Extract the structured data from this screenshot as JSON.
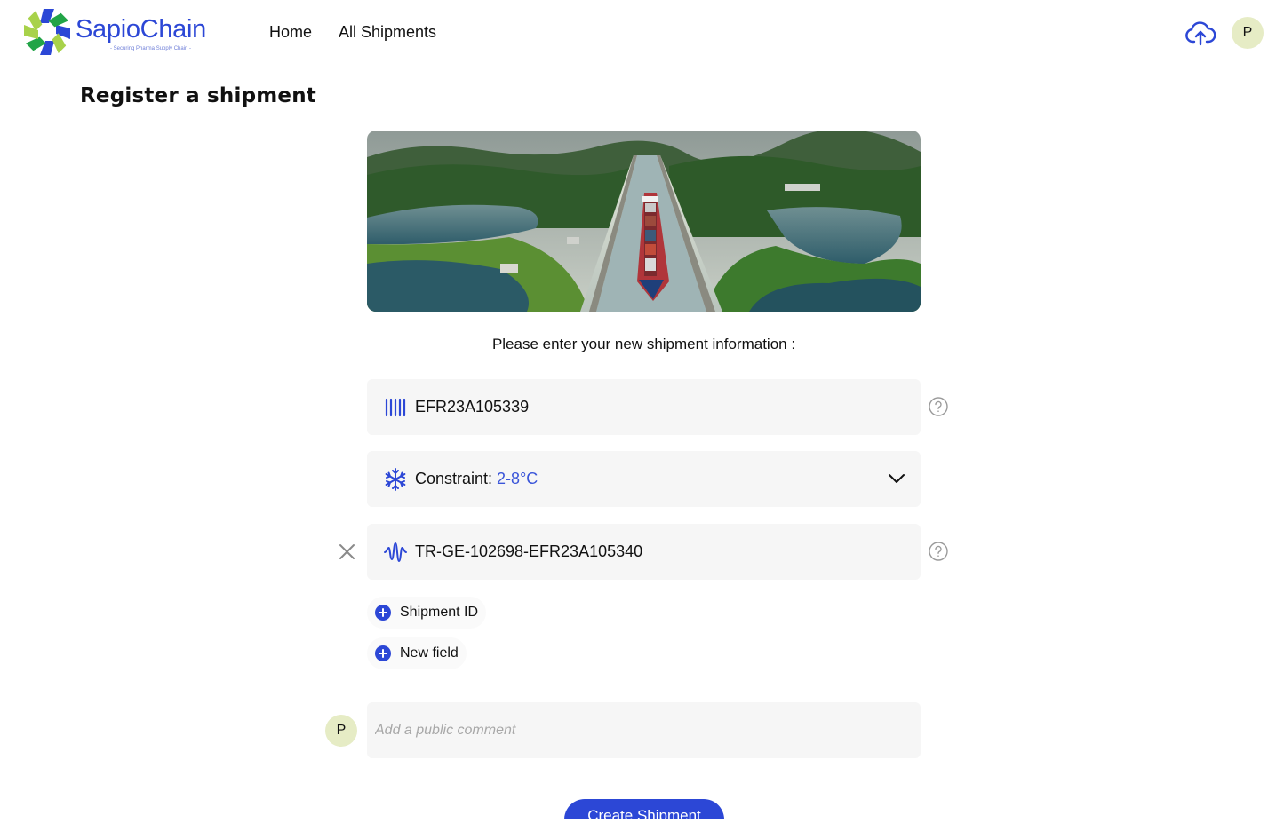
{
  "brand": {
    "name": "SapioChain",
    "tagline": "- Securing Pharma Supply Chain -"
  },
  "nav": {
    "home": "Home",
    "all_shipments": "All Shipments"
  },
  "user": {
    "initial": "P"
  },
  "page": {
    "title": "Register a shipment",
    "prompt": "Please enter your new shipment information :"
  },
  "hero": {
    "alt": "Container ship in canal locks"
  },
  "fields": {
    "tracking_number": {
      "value": "EFR23A105339",
      "icon": "barcode-icon"
    },
    "constraint": {
      "label": "Constraint:",
      "value": "2-8°C",
      "icon": "snowflake-icon"
    },
    "sensor_id": {
      "value": "TR-GE-102698-EFR23A105340",
      "icon": "waveform-icon"
    }
  },
  "add_buttons": {
    "shipment_id": "Shipment ID",
    "new_field": "New field"
  },
  "comment": {
    "placeholder": "Add a public comment"
  },
  "submit": {
    "label": "Create Shipment"
  },
  "colors": {
    "accent": "#2c47d6",
    "field_bg": "#f6f6f6",
    "avatar_bg": "#e6ecc5"
  }
}
